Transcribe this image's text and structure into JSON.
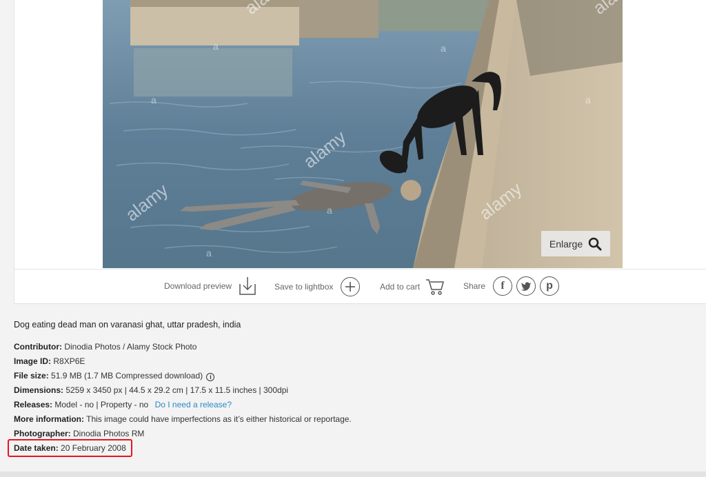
{
  "photo": {
    "watermarks": [
      "alamy",
      "alamy",
      "alamy",
      "alamy",
      "alamy"
    ],
    "enlarge_label": "Enlarge"
  },
  "actions": {
    "download_preview": "Download preview",
    "save_to_lightbox": "Save to lightbox",
    "add_to_cart": "Add to cart",
    "share": "Share"
  },
  "details": {
    "caption": "Dog eating dead man on varanasi ghat, uttar pradesh, india",
    "contributor_label": "Contributor:",
    "contributor_value": "Dinodia Photos / Alamy Stock Photo",
    "image_id_label": "Image ID:",
    "image_id_value": "R8XP6E",
    "file_size_label": "File size:",
    "file_size_value": "51.9 MB (1.7 MB Compressed download)",
    "dimensions_label": "Dimensions:",
    "dimensions_value": "5259 x 3450 px | 44.5 x 29.2 cm | 17.5 x 11.5 inches | 300dpi",
    "releases_label": "Releases:",
    "releases_value": "Model - no | Property - no",
    "releases_link": "Do I need a release?",
    "more_info_label": "More information:",
    "more_info_value": "This image could have imperfections as it’s either historical or reportage.",
    "photographer_label": "Photographer:",
    "photographer_value": "Dinodia Photos RM",
    "date_taken_label": "Date taken:",
    "date_taken_value": "20 February 2008"
  },
  "colors": {
    "highlight": "#e8141d",
    "link": "#2a8ac7"
  }
}
